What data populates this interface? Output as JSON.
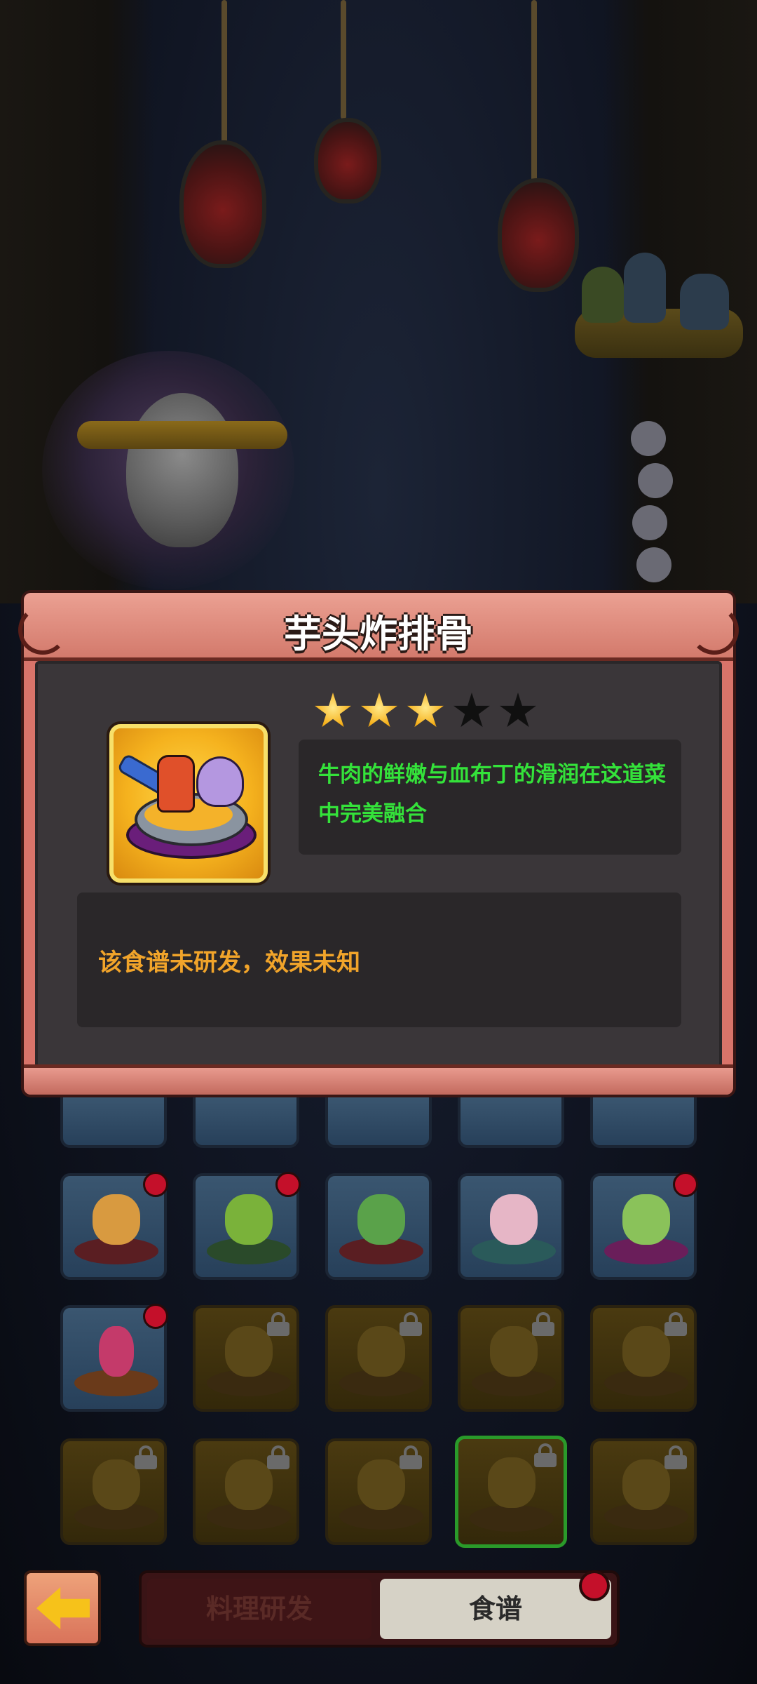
{
  "dialog": {
    "title": "芋头炸排骨",
    "rating": {
      "filled": 3,
      "total": 5
    },
    "description": "牛肉的鲜嫩与血布丁的滑润在这道菜中完美融合",
    "effect": "该食谱未研发，效果未知"
  },
  "recipe_grid": {
    "rows": [
      [
        {
          "state": "unlocked",
          "new": true,
          "icon": "dish-icon"
        },
        {
          "state": "unlocked",
          "new": true,
          "icon": "dish-icon"
        },
        {
          "state": "unlocked",
          "new": false,
          "icon": "dish-icon"
        },
        {
          "state": "unlocked",
          "new": false,
          "icon": "dish-icon"
        },
        {
          "state": "unlocked",
          "new": true,
          "icon": "dish-icon"
        }
      ],
      [
        {
          "state": "unlocked",
          "new": true,
          "icon": "dish-icon"
        },
        {
          "state": "locked",
          "icon": "lock-icon"
        },
        {
          "state": "locked",
          "icon": "lock-icon"
        },
        {
          "state": "locked",
          "icon": "lock-icon"
        },
        {
          "state": "locked",
          "icon": "lock-icon"
        }
      ],
      [
        {
          "state": "locked",
          "icon": "lock-icon"
        },
        {
          "state": "locked",
          "icon": "lock-icon"
        },
        {
          "state": "locked",
          "icon": "lock-icon"
        },
        {
          "state": "locked",
          "selected": true,
          "icon": "lock-icon"
        },
        {
          "state": "locked",
          "icon": "lock-icon"
        }
      ]
    ]
  },
  "bottom_bar": {
    "back_icon": "arrow-left-icon",
    "tabs": [
      {
        "label": "料理研发",
        "active": false
      },
      {
        "label": "食谱",
        "active": true
      }
    ],
    "recipe_tab_notification": true
  },
  "colors": {
    "description_text": "#34e23a",
    "effect_text": "#f1a42a",
    "star_on": "#f6b11c",
    "notification": "#c4102a"
  }
}
